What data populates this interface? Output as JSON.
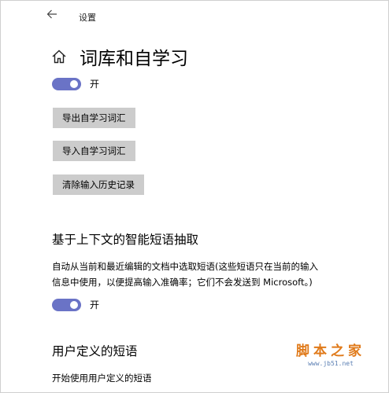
{
  "titlebar": {
    "back_icon": "arrow-left-icon",
    "title": "设置"
  },
  "header": {
    "home_icon": "home-icon",
    "title": "词库和自学习"
  },
  "self_learning": {
    "toggle_state": "on",
    "toggle_label": "开",
    "accent_color": "#6a73c6",
    "buttons": {
      "export": "导出自学习词汇",
      "import": "导入自学习词汇",
      "clear_history": "清除输入历史记录"
    }
  },
  "phrase_extraction": {
    "title": "基于上下文的智能短语抽取",
    "description_line1": "自动从当前和最近编辑的文档中选取短语(这些短语只在当前的输入",
    "description_line2": "信息中使用，以便提高输入准确率；它们不会发送到 Microsoft。)",
    "toggle_state": "on",
    "toggle_label": "开"
  },
  "user_phrases": {
    "title": "用户定义的短语",
    "start_label": "开始使用用户定义的短语"
  },
  "watermark": {
    "brand": "脚本之家",
    "url": "www.jb51.net",
    "color": "#e07a1a"
  }
}
